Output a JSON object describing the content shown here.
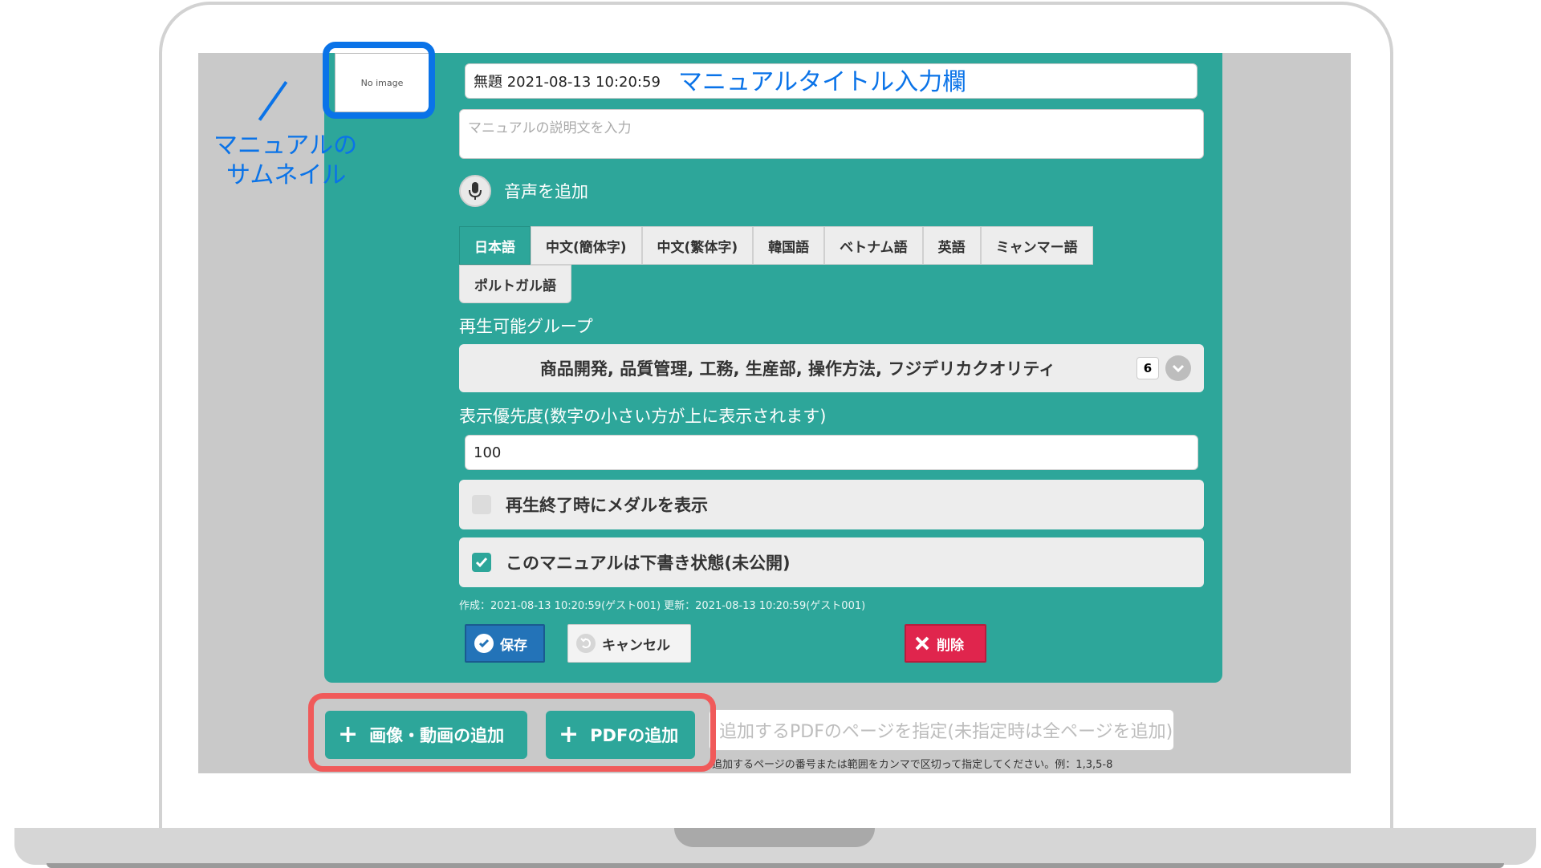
{
  "thumbnail": {
    "text": "No image"
  },
  "title_input": {
    "value": "無題 2021-08-13 10:20:59"
  },
  "description_input": {
    "placeholder": "マニュアルの説明文を入力"
  },
  "audio": {
    "label": "音声を追加"
  },
  "language_tabs": [
    "日本語",
    "中文(簡体字)",
    "中文(繁体字)",
    "韓国語",
    "ベトナム語",
    "英語",
    "ミャンマー語",
    "ポルトガル語"
  ],
  "active_tab": "日本語",
  "playable_groups": {
    "label": "再生可能グループ",
    "value": "商品開発, 品質管理, 工務, 生産部, 操作方法, フジデリカクオリティ",
    "count": "6"
  },
  "priority": {
    "label": "表示優先度(数字の小さい方が上に表示されます)",
    "value": "100"
  },
  "checkbox_medal": {
    "label": "再生終了時にメダルを表示",
    "checked": false
  },
  "checkbox_draft": {
    "label": "このマニュアルは下書き状態(未公開)",
    "checked": true
  },
  "meta": "作成：2021-08-13 10:20:59(ゲスト001)  更新：2021-08-13 10:20:59(ゲスト001)",
  "buttons": {
    "save": "保存",
    "cancel": "キャンセル",
    "delete": "削除"
  },
  "bottom": {
    "add_media": "画像・動画の追加",
    "add_pdf": "PDFの追加",
    "pdf_pages_placeholder": "追加するPDFのページを指定(未指定時は全ページを追加)",
    "pdf_help": "追加するページの番号または範囲をカンマで区切って指定してください。例：1,3,5-8"
  },
  "annotations": {
    "title_note": "マニュアルタイトル入力欄",
    "thumb_note_line1": "マニュアルの",
    "thumb_note_line2": "サムネイル"
  },
  "colors": {
    "teal": "#2da69a",
    "blue_annotation": "#0a73e8",
    "red_annotation": "#f05a5a"
  }
}
